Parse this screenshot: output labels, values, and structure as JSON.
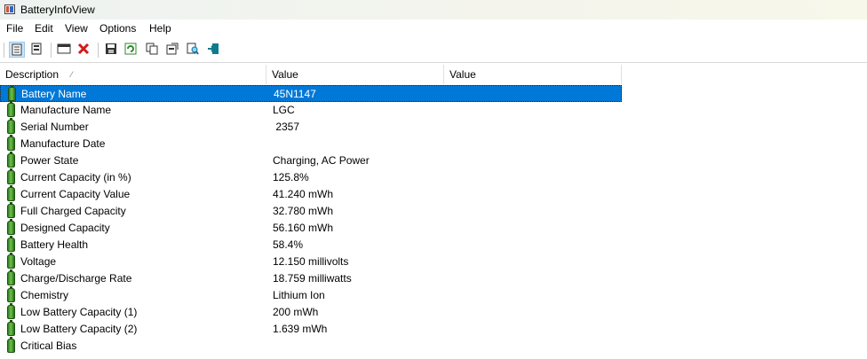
{
  "window": {
    "title": "BatteryInfoView"
  },
  "menu": [
    "File",
    "Edit",
    "View",
    "Options",
    "Help"
  ],
  "toolbar": [
    "html-report-icon",
    "text-report-icon",
    "properties-icon",
    "delete-icon",
    "save-icon",
    "refresh-icon",
    "copy-icon",
    "options-icon",
    "find-icon",
    "exit-icon"
  ],
  "columns": [
    "Description",
    "Value",
    "Value"
  ],
  "rows": [
    {
      "description": "Battery Name",
      "value": "45N1147"
    },
    {
      "description": "Manufacture Name",
      "value": "LGC"
    },
    {
      "description": "Serial Number",
      "value": " 2357"
    },
    {
      "description": "Manufacture Date",
      "value": ""
    },
    {
      "description": "Power State",
      "value": "Charging, AC Power"
    },
    {
      "description": "Current Capacity (in %)",
      "value": "125.8%"
    },
    {
      "description": "Current Capacity Value",
      "value": "41.240 mWh"
    },
    {
      "description": "Full Charged Capacity",
      "value": "32.780 mWh"
    },
    {
      "description": "Designed Capacity",
      "value": "56.160 mWh"
    },
    {
      "description": "Battery Health",
      "value": "58.4%"
    },
    {
      "description": "Voltage",
      "value": "12.150 millivolts"
    },
    {
      "description": "Charge/Discharge Rate",
      "value": "18.759 milliwatts"
    },
    {
      "description": "Chemistry",
      "value": "Lithium Ion"
    },
    {
      "description": "Low Battery Capacity (1)",
      "value": "200 mWh"
    },
    {
      "description": "Low Battery Capacity (2)",
      "value": "1.639 mWh"
    },
    {
      "description": "Critical Bias",
      "value": ""
    }
  ],
  "selected_row": 0
}
